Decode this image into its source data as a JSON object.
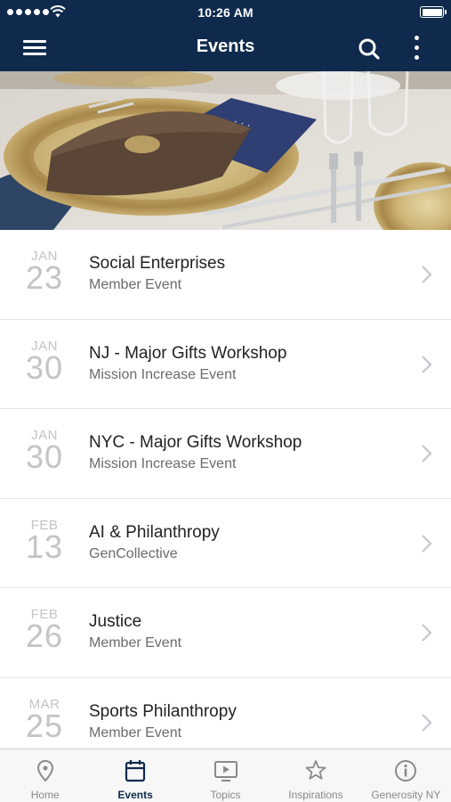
{
  "status_bar": {
    "time": "10:26 AM"
  },
  "navbar": {
    "title": "Events",
    "menu_icon": "hamburger-menu-icon",
    "search_icon": "search-icon",
    "more_icon": "more-vertical-icon"
  },
  "hero": {
    "image_description_icon": "hero-image"
  },
  "events": [
    {
      "month": "JAN",
      "day": "23",
      "title": "Social Enterprises",
      "subtitle": "Member Event"
    },
    {
      "month": "JAN",
      "day": "30",
      "title": "NJ - Major Gifts Workshop",
      "subtitle": "Mission Increase Event"
    },
    {
      "month": "JAN",
      "day": "30",
      "title": "NYC - Major Gifts Workshop",
      "subtitle": "Mission Increase Event"
    },
    {
      "month": "FEB",
      "day": "13",
      "title": "AI & Philanthropy",
      "subtitle": "GenCollective"
    },
    {
      "month": "FEB",
      "day": "26",
      "title": "Justice",
      "subtitle": "Member Event"
    },
    {
      "month": "MAR",
      "day": "25",
      "title": "Sports Philanthropy",
      "subtitle": "Member Event"
    }
  ],
  "tabs": [
    {
      "label": "Home",
      "icon": "location-pin-icon",
      "active": false
    },
    {
      "label": "Events",
      "icon": "calendar-icon",
      "active": true
    },
    {
      "label": "Topics",
      "icon": "tv-play-icon",
      "active": false
    },
    {
      "label": "Inspirations",
      "icon": "star-icon",
      "active": false
    },
    {
      "label": "Generosity NY",
      "icon": "info-icon",
      "active": false
    }
  ],
  "colors": {
    "navbar": "#0f2a4d",
    "active_tab": "#0f2a4d",
    "inactive_tab": "#8a8a8a",
    "date_text": "#c4c4c4"
  }
}
